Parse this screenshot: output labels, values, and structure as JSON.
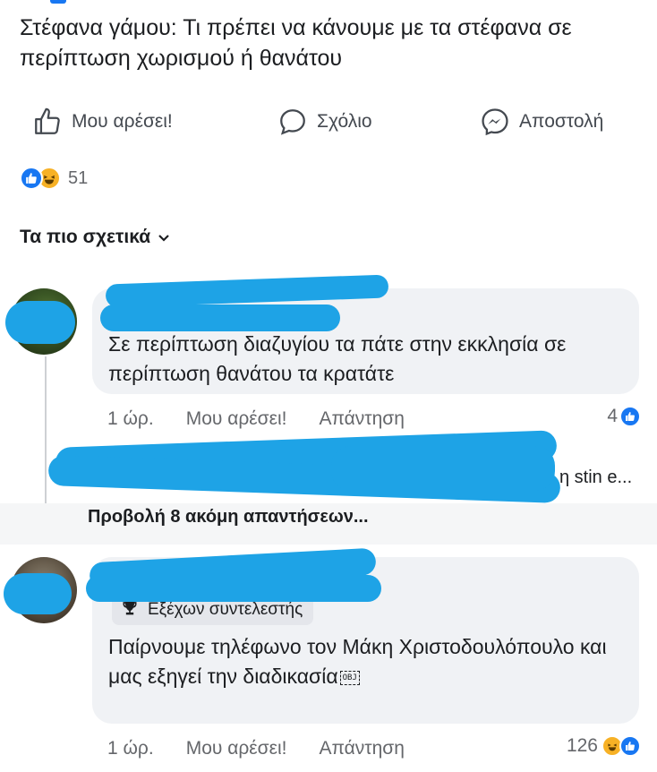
{
  "post": {
    "title": "Στέφανα γάμου: Τι πρέπει να κάνουμε με τα στέφανα σε περίπτωση χωρισμού ή θανάτου"
  },
  "actions": {
    "like": "Μου αρέσει!",
    "comment": "Σχόλιο",
    "share": "Αποστολή"
  },
  "reactions": {
    "count": "51",
    "types": [
      "like-icon",
      "haha-icon"
    ]
  },
  "sort": {
    "label": "Τα πιο σχετικά"
  },
  "comments": [
    {
      "text": "Σε περίπτωση διαζυγίου τα πάτε στην εκκλησία σε περίπτωση θανάτου τα κρατάτε",
      "time": "1 ώρ.",
      "like_label": "Μου αρέσει!",
      "reply_label": "Απάντηση",
      "reaction_count": "4",
      "reply_preview_tail": "η stin e...",
      "more_replies": "Προβολή 8 ακόμη απαντήσεων..."
    },
    {
      "badge": "Εξέχων συντελεστής",
      "text": "Παίρνουμε τηλέφωνο τον Μάκη Χριστοδουλόπουλο και μας εξηγεί την διαδικασία",
      "obj_marker": "OBJ",
      "time": "1 ώρ.",
      "like_label": "Μου αρέσει!",
      "reply_label": "Απάντηση",
      "reaction_count": "126"
    }
  ],
  "colors": {
    "facebook_blue": "#1877f2",
    "haha_yellow": "#f7b125",
    "redaction_blue": "#1ea3e6",
    "bubble_bg": "#f0f2f5",
    "secondary_text": "#65676b"
  }
}
